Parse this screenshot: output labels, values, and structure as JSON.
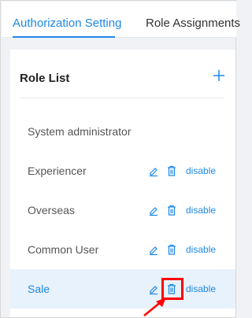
{
  "tabs": [
    {
      "label": "Authorization Setting",
      "active": true
    },
    {
      "label": "Role Assignments",
      "active": false
    }
  ],
  "role_list": {
    "title": "Role List",
    "add_icon": "plus-icon",
    "roles": [
      {
        "name": "System administrator",
        "actions": false,
        "selected": false
      },
      {
        "name": "Experiencer",
        "actions": true,
        "selected": false,
        "action_label": "disable"
      },
      {
        "name": "Overseas",
        "actions": true,
        "selected": false,
        "action_label": "disable"
      },
      {
        "name": "Common User",
        "actions": true,
        "selected": false,
        "action_label": "disable"
      },
      {
        "name": "Sale",
        "actions": true,
        "selected": true,
        "action_label": "disable"
      }
    ]
  },
  "colors": {
    "accent": "#1e88e5",
    "selected_row": "#e8f2fc",
    "highlight": "#ff0000"
  },
  "icons": {
    "edit": "edit-icon",
    "delete": "trash-icon",
    "annotation": "arrow-icon"
  }
}
